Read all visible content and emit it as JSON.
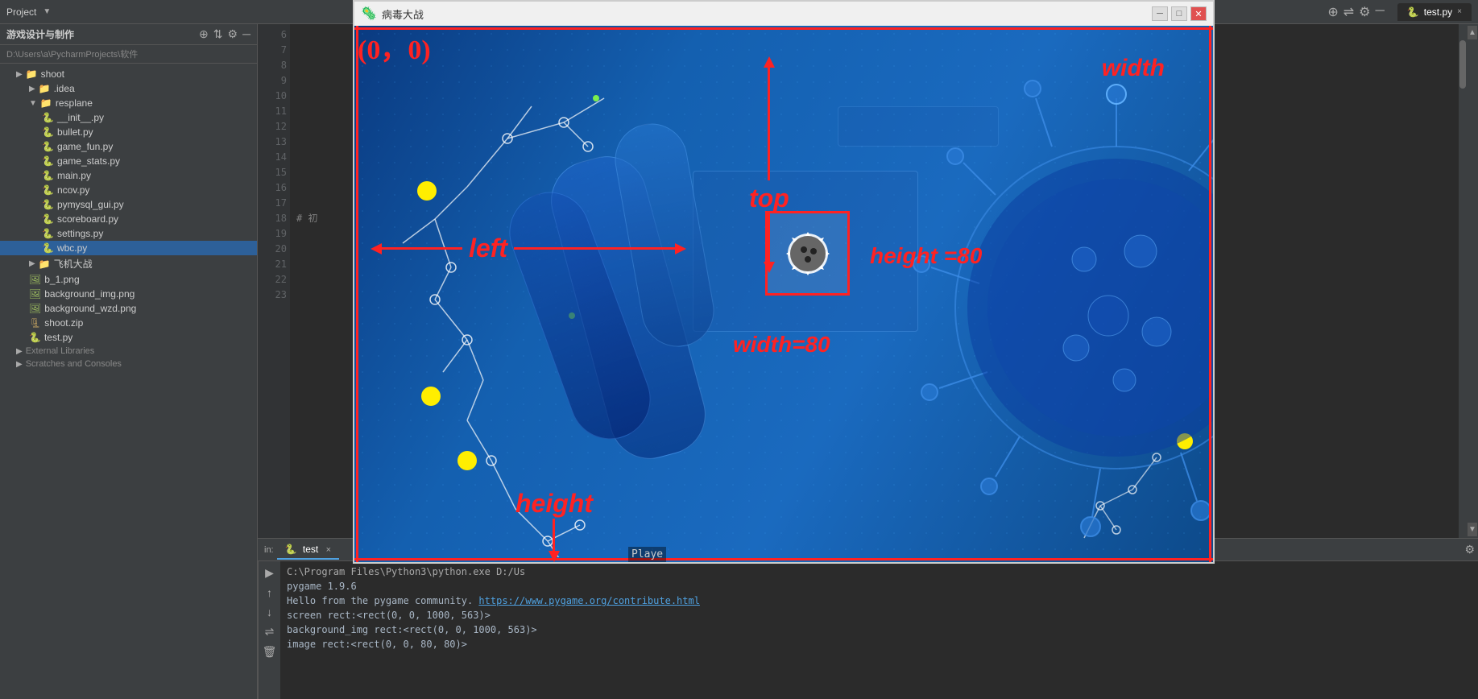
{
  "app": {
    "title": "Project",
    "tab_active": "test.py",
    "path": "D:\\Users\\a\\PycharmProjects\\软件"
  },
  "sidebar": {
    "header": "游戏设计与制作",
    "path_label": "D:\\Users\\a\\PycharmProjects\\软件",
    "tree_items": [
      {
        "id": "shoot",
        "label": "shoot",
        "type": "folder",
        "indent": 1,
        "expanded": true
      },
      {
        "id": "idea",
        "label": ".idea",
        "type": "folder",
        "indent": 2,
        "expanded": false
      },
      {
        "id": "resplane",
        "label": "resplane",
        "type": "folder",
        "indent": 2,
        "expanded": true
      },
      {
        "id": "init",
        "label": "__init__.py",
        "type": "py",
        "indent": 3
      },
      {
        "id": "bullet",
        "label": "bullet.py",
        "type": "py",
        "indent": 3
      },
      {
        "id": "game_fun",
        "label": "game_fun.py",
        "type": "py",
        "indent": 3
      },
      {
        "id": "game_stats",
        "label": "game_stats.py",
        "type": "py",
        "indent": 3
      },
      {
        "id": "main",
        "label": "main.py",
        "type": "py",
        "indent": 3
      },
      {
        "id": "ncov",
        "label": "ncov.py",
        "type": "py",
        "indent": 3
      },
      {
        "id": "pymysql_gui",
        "label": "pymysql_gui.py",
        "type": "py",
        "indent": 3
      },
      {
        "id": "scoreboard",
        "label": "scoreboard.py",
        "type": "py",
        "indent": 3
      },
      {
        "id": "settings",
        "label": "settings.py",
        "type": "py",
        "indent": 3
      },
      {
        "id": "wbc",
        "label": "wbc.py",
        "type": "py",
        "indent": 3,
        "selected": true
      },
      {
        "id": "feijidazhan",
        "label": "飞机大战",
        "type": "folder",
        "indent": 2,
        "expanded": true
      },
      {
        "id": "b1",
        "label": "b_1.png",
        "type": "png",
        "indent": 2
      },
      {
        "id": "bg_img",
        "label": "background_img.png",
        "type": "png",
        "indent": 2
      },
      {
        "id": "bg_wzd",
        "label": "background_wzd.png",
        "type": "png",
        "indent": 2
      },
      {
        "id": "shoot_zip",
        "label": "shoot.zip",
        "type": "zip",
        "indent": 2
      },
      {
        "id": "test_py",
        "label": "test.py",
        "type": "py",
        "indent": 2
      }
    ],
    "external_libraries": "External Libraries",
    "scratches": "Scratches and Consoles"
  },
  "editor": {
    "lines": [
      "6",
      "7",
      "8",
      "9",
      "10",
      "11",
      "12",
      "13",
      "14",
      "15",
      "16",
      "17",
      "18",
      "19",
      "20",
      "21",
      "22",
      "23"
    ],
    "code_lines": [
      "",
      "",
      "",
      "",
      "",
      "",
      "",
      "",
      "",
      "",
      "",
      "",
      "# 初",
      ""
    ]
  },
  "bottom_panel": {
    "tab_label": "test",
    "close_label": "×",
    "console_lines": [
      "C:\\Program Files\\Python3\\python.exe  D:/Us",
      "pygame 1.9.6",
      "Hello from the pygame community.  https://www.pygame.org/contribute.html",
      "screen rect:<rect(0, 0, 1000, 563)>",
      "background_img rect:<rect(0, 0, 1000, 563)>",
      "image rect:<rect(0, 0, 80, 80)>"
    ],
    "link_text": "https://www.pygame.org/contribute.html"
  },
  "game_window": {
    "title": "病毒大战",
    "icon": "🦠",
    "annotations": {
      "coord": "(0，0)",
      "top_label": "top",
      "left_label": "left",
      "width_label": "width",
      "height_label": "height",
      "height_eq": "height =80",
      "width_eq": "width=80"
    }
  }
}
